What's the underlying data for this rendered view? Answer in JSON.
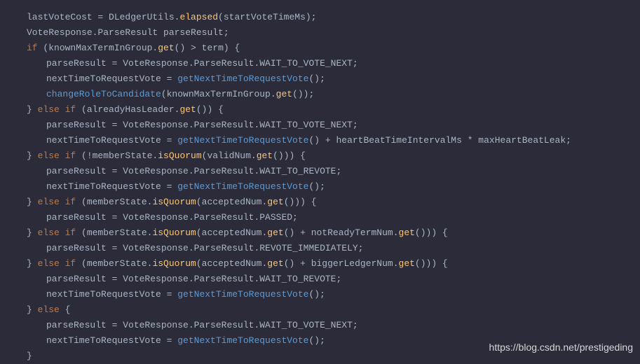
{
  "code": {
    "l1_a": "lastVoteCost = DLedgerUtils.",
    "l1_m": "elapsed",
    "l1_b": "(startVoteTimeMs);",
    "l2": "VoteResponse.ParseResult parseResult;",
    "l3_kw": "if",
    "l3_a": " (knownMaxTermInGroup.",
    "l3_m": "get",
    "l3_b": "() > term) {",
    "l4": "parseResult = VoteResponse.ParseResult.WAIT_TO_VOTE_NEXT;",
    "l5_a": "nextTimeToRequestVote = ",
    "l5_m": "getNextTimeToRequestVote",
    "l5_b": "();",
    "l6_m": "changeRoleToCandidate",
    "l6_a": "(knownMaxTermInGroup.",
    "l6_m2": "get",
    "l6_b": "());",
    "l7_a": "} ",
    "l7_kw": "else if",
    "l7_b": " (alreadyHasLeader.",
    "l7_m": "get",
    "l7_c": "()) {",
    "l8": "parseResult = VoteResponse.ParseResult.WAIT_TO_VOTE_NEXT;",
    "l9_a": "nextTimeToRequestVote = ",
    "l9_m": "getNextTimeToRequestVote",
    "l9_b": "() + heartBeatTimeIntervalMs * maxHeartBeatLeak;",
    "l10_a": "} ",
    "l10_kw": "else if",
    "l10_b": " (!memberState.",
    "l10_m": "isQuorum",
    "l10_c": "(validNum.",
    "l10_m2": "get",
    "l10_d": "())) {",
    "l11": "parseResult = VoteResponse.ParseResult.WAIT_TO_REVOTE;",
    "l12_a": "nextTimeToRequestVote = ",
    "l12_m": "getNextTimeToRequestVote",
    "l12_b": "();",
    "l13_a": "} ",
    "l13_kw": "else if",
    "l13_b": " (memberState.",
    "l13_m": "isQuorum",
    "l13_c": "(acceptedNum.",
    "l13_m2": "get",
    "l13_d": "())) {",
    "l14": "parseResult = VoteResponse.ParseResult.PASSED;",
    "l15_a": "} ",
    "l15_kw": "else if",
    "l15_b": " (memberState.",
    "l15_m": "isQuorum",
    "l15_c": "(acceptedNum.",
    "l15_m2": "get",
    "l15_d": "() + notReadyTermNum.",
    "l15_m3": "get",
    "l15_e": "())) {",
    "l16": "parseResult = VoteResponse.ParseResult.REVOTE_IMMEDIATELY;",
    "l17_a": "} ",
    "l17_kw": "else if",
    "l17_b": " (memberState.",
    "l17_m": "isQuorum",
    "l17_c": "(acceptedNum.",
    "l17_m2": "get",
    "l17_d": "() + biggerLedgerNum.",
    "l17_m3": "get",
    "l17_e": "())) {",
    "l18": "parseResult = VoteResponse.ParseResult.WAIT_TO_REVOTE;",
    "l19_a": "nextTimeToRequestVote = ",
    "l19_m": "getNextTimeToRequestVote",
    "l19_b": "();",
    "l20_a": "} ",
    "l20_kw": "else",
    "l20_b": " {",
    "l21": "parseResult = VoteResponse.ParseResult.WAIT_TO_VOTE_NEXT;",
    "l22_a": "nextTimeToRequestVote = ",
    "l22_m": "getNextTimeToRequestVote",
    "l22_b": "();",
    "l23": "}"
  },
  "watermark": "https://blog.csdn.net/prestigeding"
}
